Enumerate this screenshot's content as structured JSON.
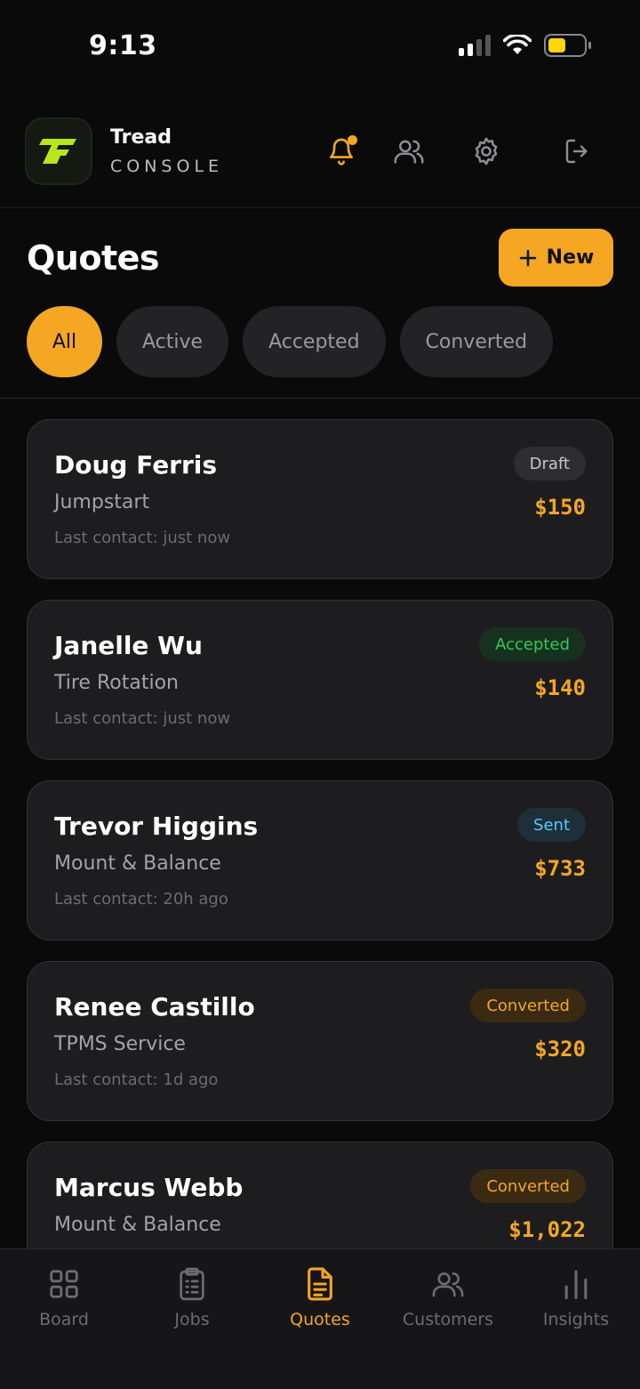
{
  "status": {
    "time": "9:13"
  },
  "brand": {
    "name": "Tread",
    "subtitle": "CONSOLE",
    "accent": "#f5a623"
  },
  "page": {
    "title": "Quotes",
    "new_label": "New"
  },
  "filters": [
    {
      "label": "All",
      "active": true
    },
    {
      "label": "Active",
      "active": false
    },
    {
      "label": "Accepted",
      "active": false
    },
    {
      "label": "Converted",
      "active": false
    }
  ],
  "quotes": [
    {
      "name": "Doug Ferris",
      "service": "Jumpstart",
      "contact": "Last contact: just now",
      "status": "Draft",
      "price": "$150",
      "badge_bg": "#2e2e31",
      "badge_fg": "#c7c7cc"
    },
    {
      "name": "Janelle Wu",
      "service": "Tire Rotation",
      "contact": "Last contact: just now",
      "status": "Accepted",
      "price": "$140",
      "badge_bg": "#16321f",
      "badge_fg": "#34c759"
    },
    {
      "name": "Trevor Higgins",
      "service": "Mount & Balance",
      "contact": "Last contact: 20h ago",
      "status": "Sent",
      "price": "$733",
      "badge_bg": "#1f2f3a",
      "badge_fg": "#5ac8fa"
    },
    {
      "name": "Renee Castillo",
      "service": "TPMS Service",
      "contact": "Last contact: 1d ago",
      "status": "Converted",
      "price": "$320",
      "badge_bg": "#3a2a12",
      "badge_fg": "#f5a623"
    },
    {
      "name": "Marcus Webb",
      "service": "Mount & Balance",
      "contact": "",
      "status": "Converted",
      "price": "$1,022",
      "badge_bg": "#3a2a12",
      "badge_fg": "#f5a623"
    }
  ],
  "tabs": [
    {
      "label": "Board",
      "icon": "grid-icon",
      "active": false
    },
    {
      "label": "Jobs",
      "icon": "clipboard-icon",
      "active": false
    },
    {
      "label": "Quotes",
      "icon": "document-icon",
      "active": true
    },
    {
      "label": "Customers",
      "icon": "users-icon",
      "active": false
    },
    {
      "label": "Insights",
      "icon": "bar-chart-icon",
      "active": false
    }
  ]
}
